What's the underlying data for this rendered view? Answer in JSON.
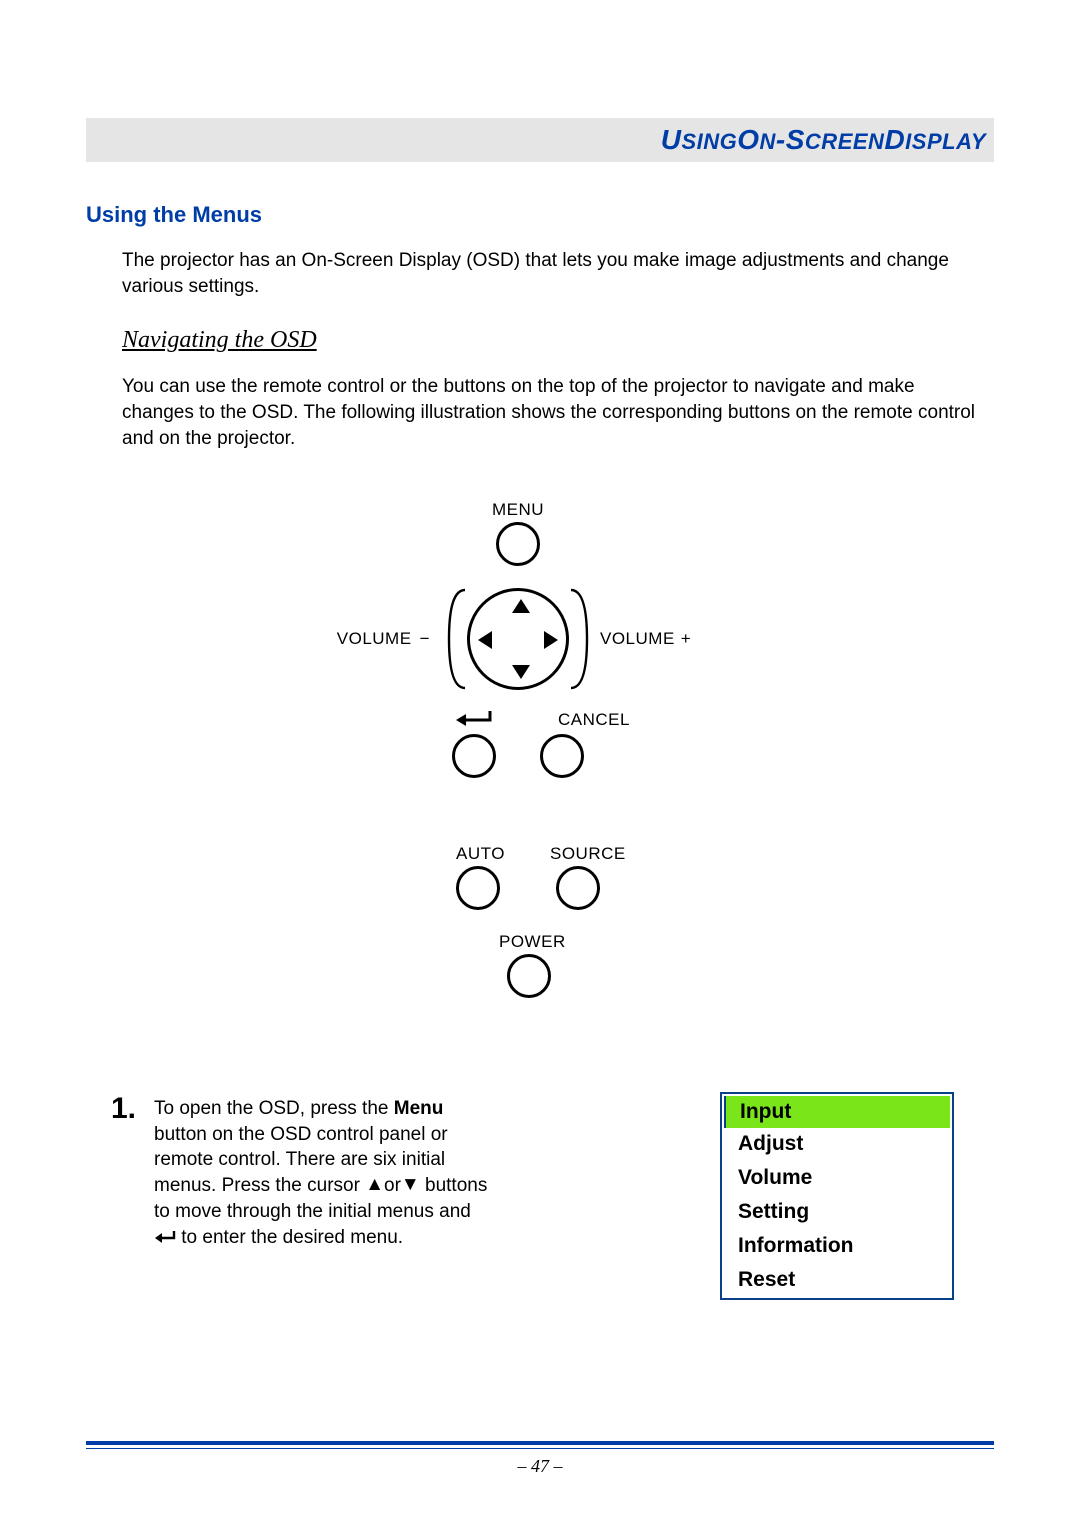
{
  "header": {
    "title_html": "U<span class='sc'>SING</span> O<span class='sc'>N</span>-S<span class='sc'>CREEN</span> D<span class='sc'>ISPLAY</span>"
  },
  "section_title": "Using the Menus",
  "intro_text": "The projector has an On-Screen Display (OSD) that lets you make image adjustments and change various settings.",
  "sub_heading": "Navigating the OSD",
  "nav_text": "You can use the remote control or the buttons on the top of the projector to navigate and make changes to the OSD. The following illustration shows the corresponding buttons on the remote control and on the projector.",
  "controls": {
    "menu": "MENU",
    "volume_minus": "VOLUME",
    "volume_plus": "VOLUME",
    "cancel": "CANCEL",
    "auto": "AUTO",
    "source": "SOURCE",
    "power": "POWER"
  },
  "step": {
    "number": "1.",
    "text_before_menu": "To open the OSD, press the ",
    "menu_word": "Menu",
    "text_after_menu": " button on the OSD control panel or remote control. There are six initial menus. Press the cursor ",
    "or_word": "or",
    "text_after_arrows": " buttons to move through the initial menus and ",
    "text_after_enter": " to enter the desired menu."
  },
  "osd_menu": {
    "items": [
      "Input",
      "Adjust",
      "Volume",
      "Setting",
      "Information",
      "Reset"
    ],
    "selected_index": 0
  },
  "page_number": "– 47 –"
}
